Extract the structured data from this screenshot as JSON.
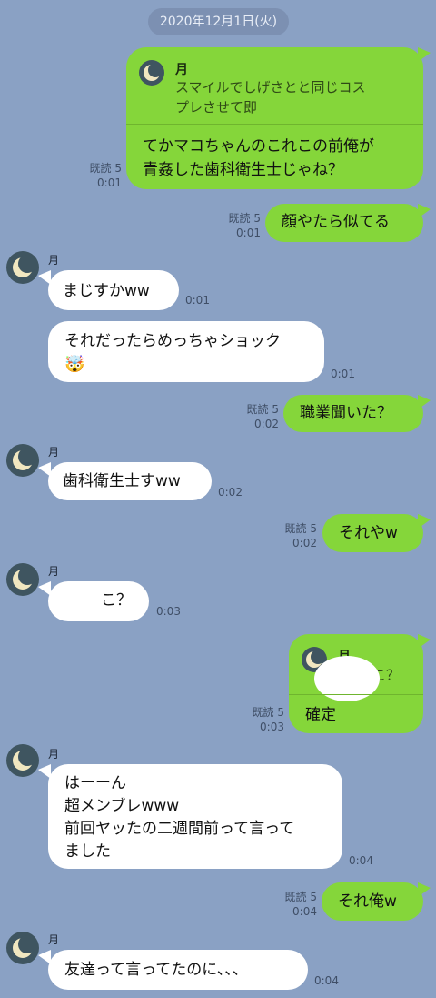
{
  "date_label": "2020年12月1日(火)",
  "icons": {
    "avatar": "crescent-moon-icon"
  },
  "colors": {
    "background": "#8aa1c4",
    "outgoing": "#85d63a",
    "incoming": "#ffffff"
  },
  "messages": [
    {
      "reply_name": "月",
      "reply_line1": "スマイルでしげさとと同じコス",
      "reply_line2": "プレさせて即",
      "line1": "てかマコちゃんのこれこの前俺が",
      "line2": "青姦した歯科衛生士じゃね？",
      "read": "既読 5",
      "time": "0:01"
    },
    {
      "text": "顔やたら似てる",
      "read": "既読 5",
      "time": "0:01"
    },
    {
      "sender": "月",
      "text": "まじすかww",
      "time": "0:01"
    },
    {
      "line1": "それだったらめっちゃショック",
      "emoji": "🤯",
      "time": "0:01"
    },
    {
      "text": "職業聞いた？",
      "read": "既読 5",
      "time": "0:02"
    },
    {
      "sender": "月",
      "text": "歯科衛生士すww",
      "time": "0:02"
    },
    {
      "text": "それやw",
      "read": "既読 5",
      "time": "0:02"
    },
    {
      "sender": "月",
      "text": "こ？",
      "time": "0:03"
    },
    {
      "reply_name": "月",
      "reply_text": "こ？",
      "text": "確定",
      "read": "既読 5",
      "time": "0:03"
    },
    {
      "sender": "月",
      "line1": "はーーん",
      "line2": "超メンブレwww",
      "line3": "前回ヤッたの二週間前って言って",
      "line4": "ました",
      "time": "0:04"
    },
    {
      "text": "それ俺w",
      "read": "既読 5",
      "time": "0:04"
    },
    {
      "sender": "月",
      "text": "友達って言ってたのに、、、",
      "time": "0:04"
    }
  ]
}
